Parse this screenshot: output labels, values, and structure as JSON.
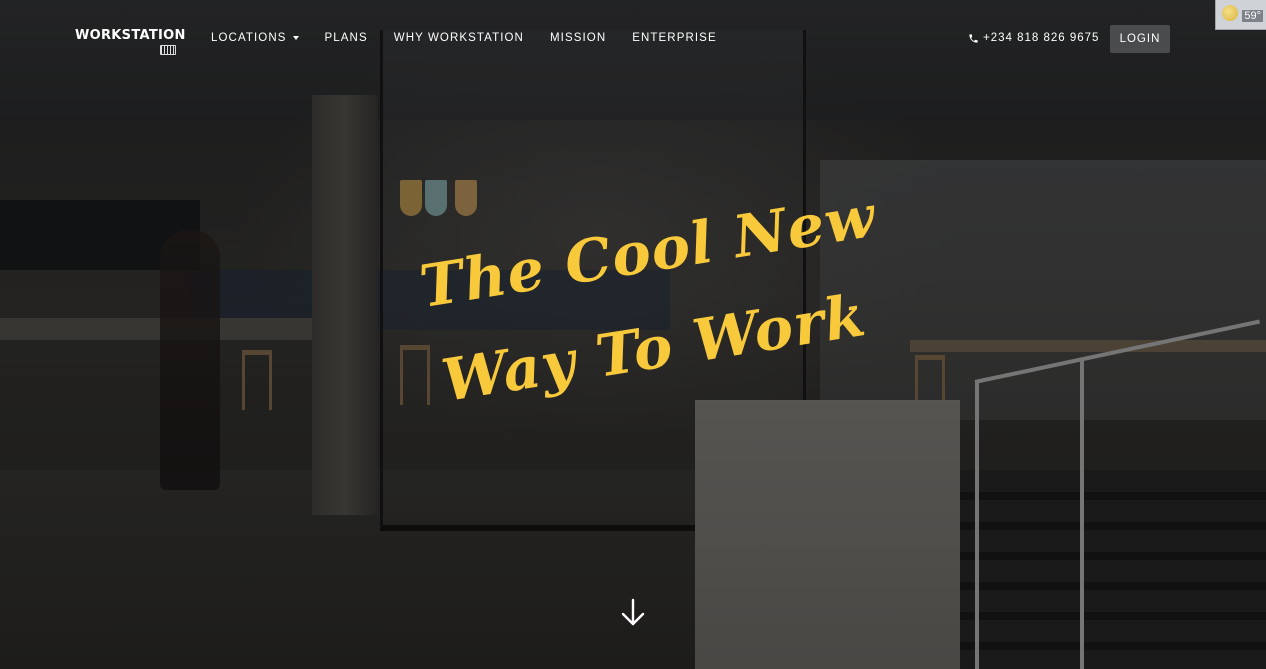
{
  "header": {
    "logo": "WORKSTATION",
    "menu": [
      {
        "label": "LOCATIONS",
        "has_dropdown": true
      },
      {
        "label": "PLANS"
      },
      {
        "label": "WHY WORKSTATION"
      },
      {
        "label": "MISSION"
      },
      {
        "label": "ENTERPRISE"
      }
    ],
    "phone": "+234 818 826 9675",
    "login_label": "LOGIN"
  },
  "weather_widget": {
    "temperature": "59°",
    "icon": "partly-sunny-icon"
  },
  "hero": {
    "headline_line1": "The Cool New",
    "headline_line2": "Way To Work",
    "headline_color": "#f7c93b",
    "scroll_icon": "arrow-down-icon"
  }
}
